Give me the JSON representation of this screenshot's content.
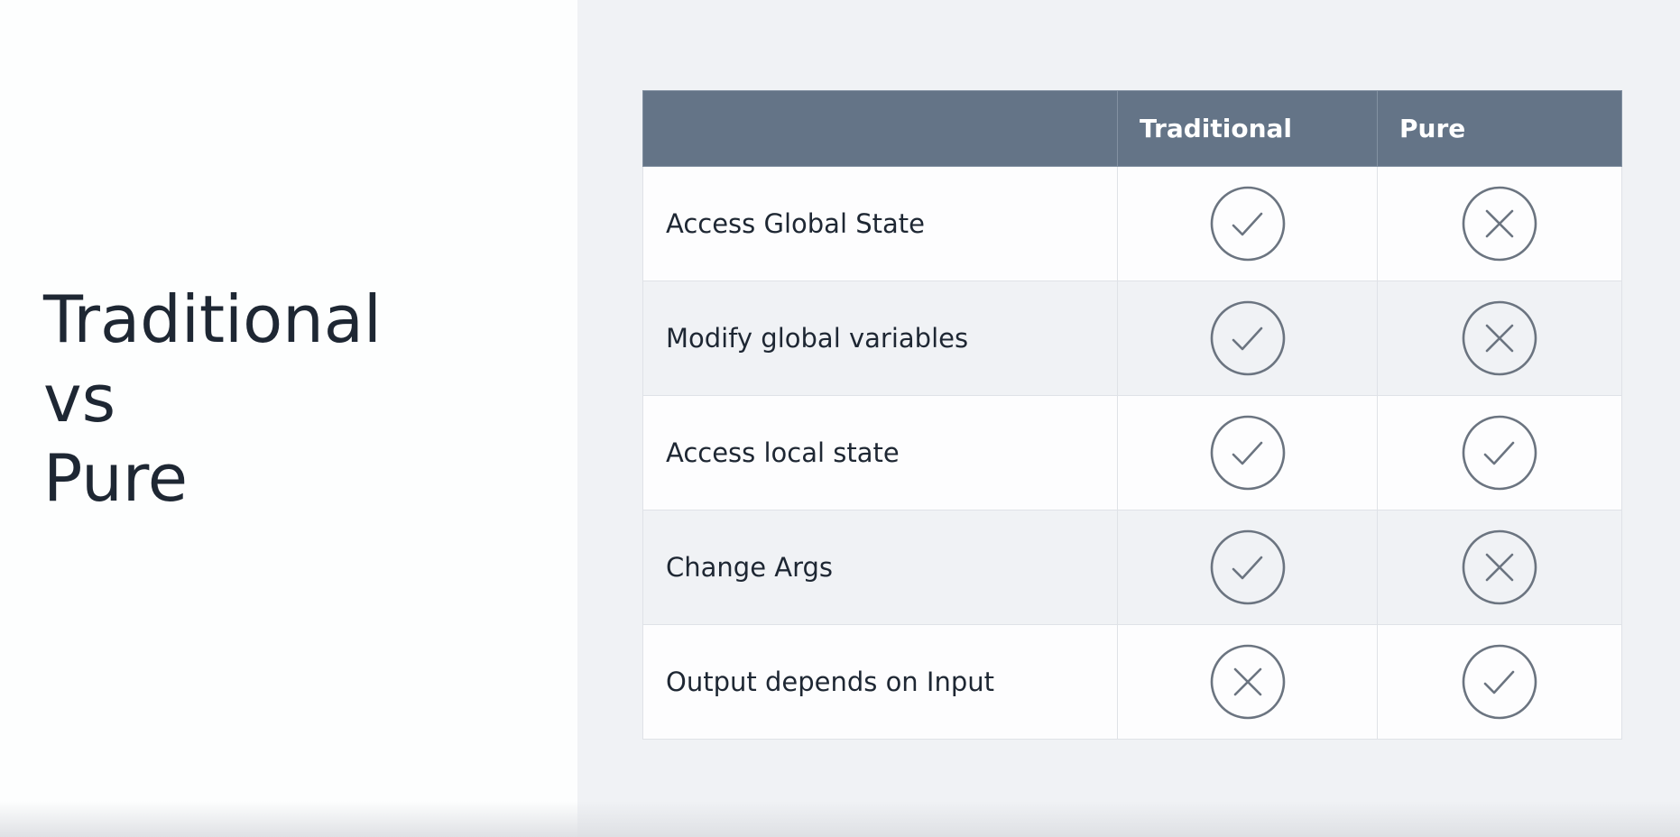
{
  "title_lines": [
    "Traditional",
    "vs",
    "Pure"
  ],
  "table": {
    "headers": [
      "",
      "Traditional",
      "Pure"
    ],
    "rows": [
      {
        "label": "Access Global State",
        "traditional": "check-icon",
        "pure": "cross-icon"
      },
      {
        "label": "Modify global variables",
        "traditional": "check-icon",
        "pure": "cross-icon"
      },
      {
        "label": "Access local state",
        "traditional": "check-icon",
        "pure": "check-icon"
      },
      {
        "label": "Change Args",
        "traditional": "check-icon",
        "pure": "cross-icon"
      },
      {
        "label": "Output depends on Input",
        "traditional": "cross-icon",
        "pure": "check-icon"
      }
    ]
  },
  "colors": {
    "header_bg": "#647487",
    "text": "#1e2733",
    "icon_stroke": "#6b7480",
    "panel_bg": "#f0f2f5"
  }
}
